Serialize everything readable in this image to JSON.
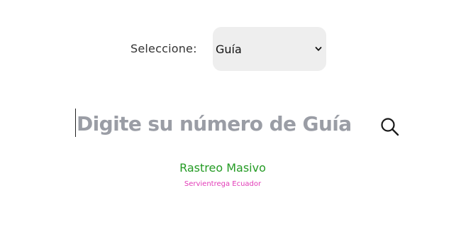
{
  "selector": {
    "label": "Seleccione:",
    "selected": "Guía",
    "chevron_icon": "chevron-down-icon"
  },
  "search": {
    "placeholder": "Digite su número de Guía",
    "value": "",
    "button_icon": "search-icon"
  },
  "links": {
    "masivo": "Rastreo Masivo"
  },
  "footer": {
    "company": "Servientrega Ecuador"
  },
  "colors": {
    "link_green": "#249b24",
    "company_pink": "#e23ab7",
    "select_bg": "#eeeeee",
    "placeholder_gray": "#9a9da5"
  }
}
